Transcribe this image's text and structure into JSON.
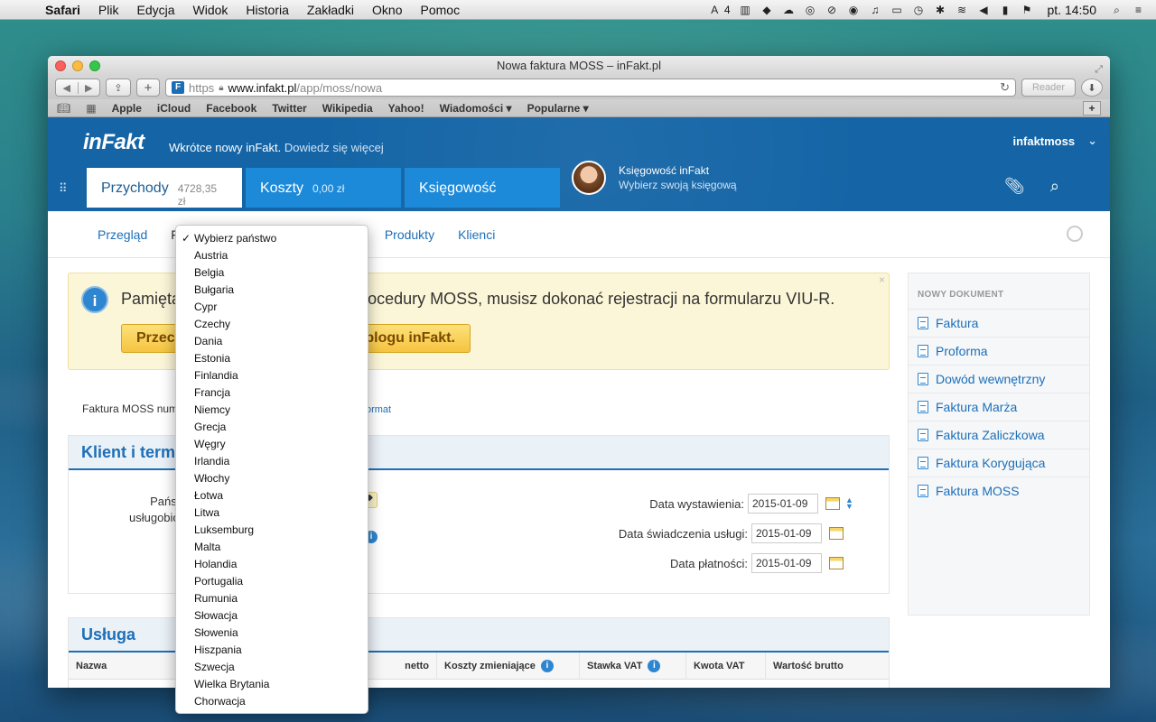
{
  "menubar": {
    "items": [
      "Safari",
      "Plik",
      "Edycja",
      "Widok",
      "Historia",
      "Zakładki",
      "Okno",
      "Pomoc"
    ],
    "status_badge": "4",
    "clock": "pt. 14:50"
  },
  "window": {
    "title": "Nowa faktura MOSS – inFakt.pl",
    "url_scheme": "https",
    "url_host": "www.infakt.pl",
    "url_path": "/app/moss/nowa",
    "reader_label": "Reader",
    "favicon_letter": "F"
  },
  "bookmarks": [
    "Apple",
    "iCloud",
    "Facebook",
    "Twitter",
    "Wikipedia",
    "Yahoo!",
    "Wiadomości ▾",
    "Popularne ▾"
  ],
  "app": {
    "logo": "inFakt",
    "tagline": "Wkrótce nowy inFakt.",
    "tagline_more": "Dowiedz się więcej",
    "user": "infaktmoss",
    "tabs": [
      {
        "label": "Przychody",
        "amount": "4728,35 zł"
      },
      {
        "label": "Koszty",
        "amount": "0,00 zł"
      },
      {
        "label": "Księgowość",
        "amount": ""
      }
    ],
    "accountant_name": "Księgowość inFakt",
    "accountant_sub": "Wybierz swoją księgową"
  },
  "subnav": {
    "items": [
      "Przegląd",
      "F",
      "Produkty",
      "Klienci"
    ]
  },
  "alert": {
    "text": "Pamiętaj, ... korzystać z procedury MOSS, musisz dokonać rejestracji na formularzu VIU-R.",
    "text_left": "Pamięta",
    "text_right": "korzystać z procedury MOSS, musisz dokonać rejestracji na formularzu VIU-R.",
    "button_left": "Przecz",
    "button_right": "ej o MOSS na blogu inFakt."
  },
  "invoice": {
    "number_label": "Faktura MOSS num",
    "format_link": "mień format"
  },
  "client_section": {
    "title": "Klient i term",
    "country_label_1": "Państwo",
    "country_label_2": "usługobiorcy",
    "dates": [
      {
        "label": "Data wystawienia:",
        "value": "2015-01-09"
      },
      {
        "label": "Data świadczenia usługi:",
        "value": "2015-01-09"
      },
      {
        "label": "Data płatności:",
        "value": "2015-01-09"
      }
    ]
  },
  "service_section": {
    "title": "Usługa",
    "columns": [
      "Nazwa",
      "netto",
      "Koszty zmieniające",
      "Stawka VAT",
      "Kwota VAT",
      "Wartość brutto"
    ]
  },
  "side_panel": {
    "title": "Nowy dokument",
    "items": [
      "Faktura",
      "Proforma",
      "Dowód wewnętrzny",
      "Faktura Marża",
      "Faktura Zaliczkowa",
      "Faktura Korygująca",
      "Faktura MOSS"
    ]
  },
  "dropdown": {
    "selected": "Wybierz państwo",
    "options": [
      "Wybierz państwo",
      "Austria",
      "Belgia",
      "Bułgaria",
      "Cypr",
      "Czechy",
      "Dania",
      "Estonia",
      "Finlandia",
      "Francja",
      "Niemcy",
      "Grecja",
      "Węgry",
      "Irlandia",
      "Włochy",
      "Łotwa",
      "Litwa",
      "Luksemburg",
      "Malta",
      "Holandia",
      "Portugalia",
      "Rumunia",
      "Słowacja",
      "Słowenia",
      "Hiszpania",
      "Szwecja",
      "Wielka Brytania",
      "Chorwacja"
    ]
  }
}
